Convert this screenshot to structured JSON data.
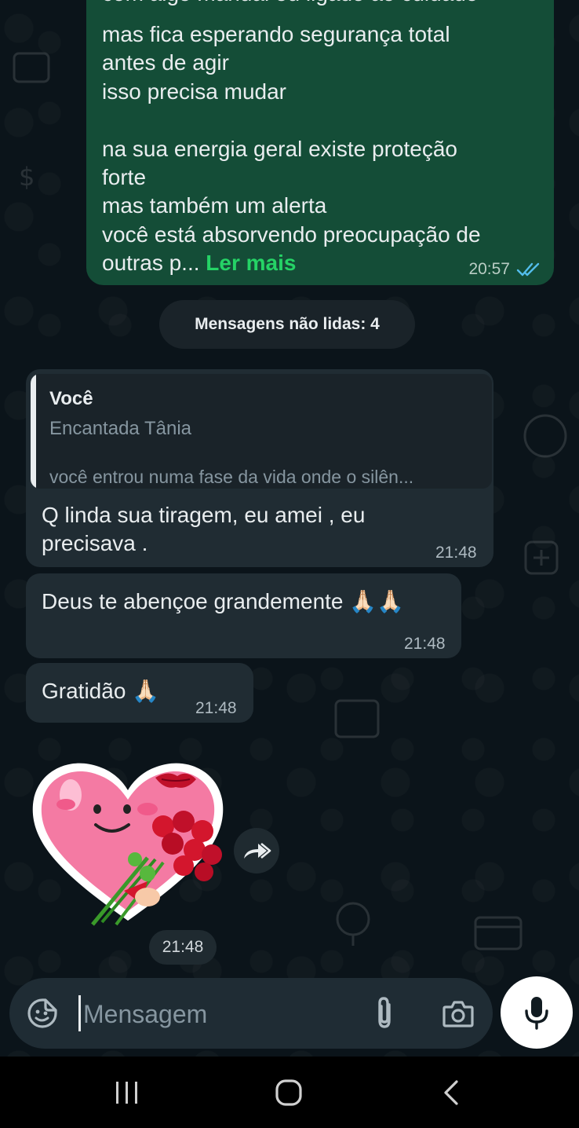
{
  "outgoing_message": {
    "lines": [
      "com algo manual ou ligado ao cuidado",
      "mas fica esperando segurança total",
      "antes de agir",
      "isso precisa mudar",
      "",
      "na sua energia geral existe proteção",
      "forte",
      "mas também um alerta",
      "você está absorvendo preocupação de"
    ],
    "last_line": "outras p...",
    "read_more": "Ler mais",
    "time": "20:57",
    "status_icon": "double-check-read-icon"
  },
  "unread_banner": "Mensagens não lidas: 4",
  "messages": [
    {
      "quote": {
        "author": "Você",
        "name": "Encantada Tânia",
        "preview": "você entrou numa fase da vida onde o silên..."
      },
      "text_line1": "Q linda sua tiragem, eu amei , eu",
      "text_line2": "precisava .",
      "time": "21:48"
    },
    {
      "text": "Deus te abençoe grandemente 🙏🏻🙏🏻",
      "time": "21:48"
    },
    {
      "text": "Gratidão 🙏🏻",
      "time": "21:48"
    }
  ],
  "sticker": {
    "icon": "heart-with-roses-sticker",
    "time": "21:48"
  },
  "composer": {
    "placeholder": "Mensagem"
  },
  "colors": {
    "outgoing_bubble": "#144d37",
    "incoming_bubble": "#202c33",
    "accent": "#25d366",
    "read_tick": "#53bdeb",
    "background": "#0b141a"
  }
}
